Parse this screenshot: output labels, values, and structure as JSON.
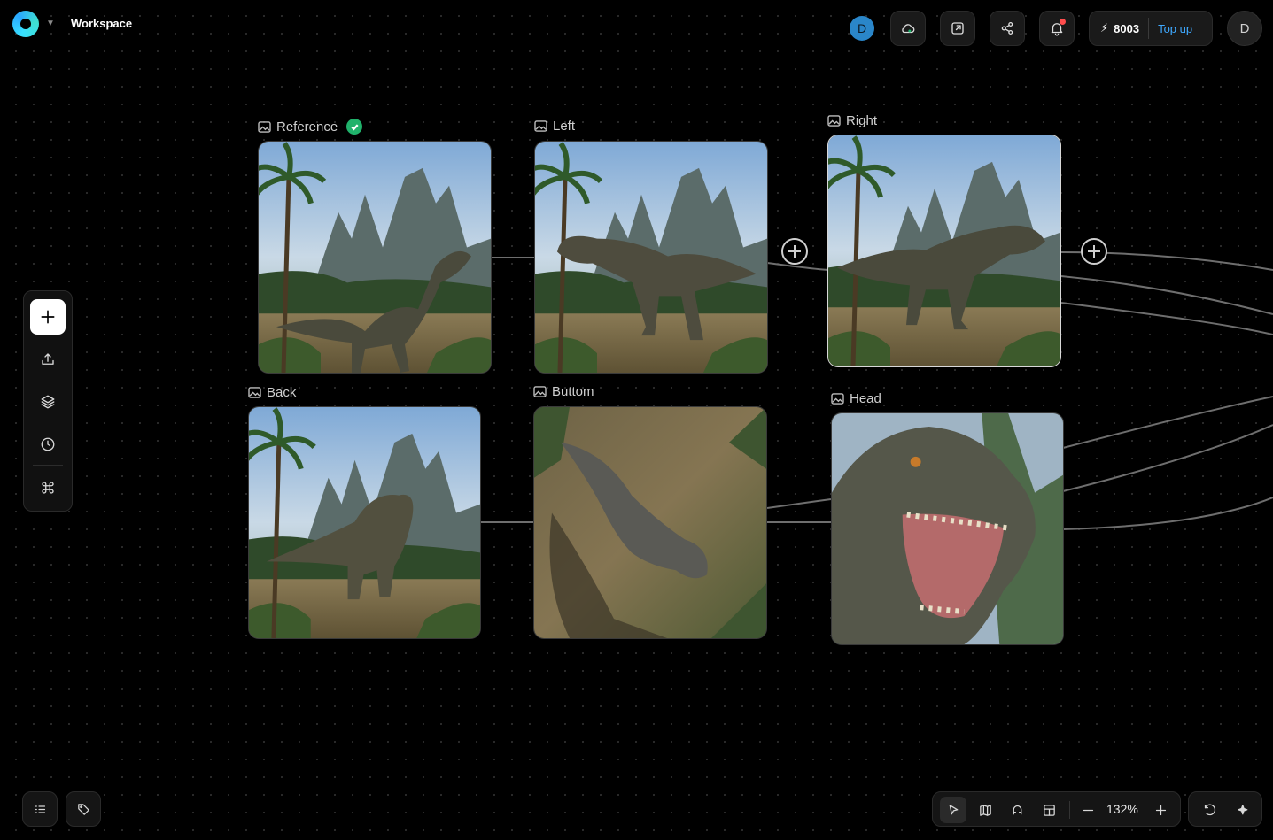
{
  "header": {
    "title": "Workspace",
    "avatar_initial": "D",
    "credits": "8003",
    "topup_label": "Top up",
    "user_initial": "D"
  },
  "nodes": {
    "reference": {
      "label": "Reference"
    },
    "left": {
      "label": "Left"
    },
    "right": {
      "label": "Right"
    },
    "back": {
      "label": "Back"
    },
    "bottom": {
      "label": "Buttom"
    },
    "head": {
      "label": "Head"
    }
  },
  "footer": {
    "zoom": "132%"
  },
  "icons": {
    "top": [
      "cloud-icon",
      "external-link-icon",
      "share-icon",
      "bell-icon",
      "bolt-icon"
    ],
    "left_toolbar": [
      "plus-icon",
      "upload-icon",
      "layers-icon",
      "clock-icon",
      "command-icon"
    ],
    "bottom": [
      "list-icon",
      "tag-icon",
      "cursor-icon",
      "map-icon",
      "magnet-icon",
      "layout-icon",
      "minus-icon",
      "plus-icon",
      "undo-icon",
      "sparkle-icon"
    ]
  },
  "colors": {
    "accent": "#3fa9ff",
    "check": "#20b26b",
    "notification": "#ff4d4d"
  }
}
